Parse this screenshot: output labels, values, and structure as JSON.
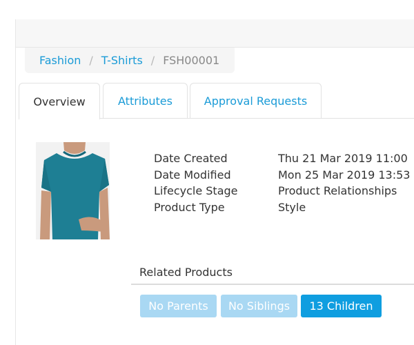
{
  "breadcrumb": {
    "items": [
      {
        "label": "Fashion"
      },
      {
        "label": "T-Shirts"
      }
    ],
    "current": "FSH00001",
    "separator": "/"
  },
  "tabs": [
    {
      "label": "Overview",
      "active": true
    },
    {
      "label": "Attributes",
      "active": false
    },
    {
      "label": "Approval Requests",
      "active": false
    }
  ],
  "product": {
    "image_icon": "product-photo-tshirt",
    "image_colors": {
      "shirt": "#1e7f94",
      "skin": "#c99a7d",
      "background": "#f2f2f2"
    },
    "details": [
      {
        "label": "Date Created",
        "value": "Thu 21 Mar 2019 11:00"
      },
      {
        "label": "Date Modified",
        "value": "Mon 25 Mar 2019 13:53"
      },
      {
        "label": "Lifecycle Stage",
        "value": "Product Relationships"
      },
      {
        "label": "Product Type",
        "value": "Style"
      }
    ]
  },
  "related": {
    "title": "Related Products",
    "buttons": [
      {
        "label": "No Parents",
        "state": "disabled"
      },
      {
        "label": "No Siblings",
        "state": "disabled"
      },
      {
        "label": "13 Children",
        "state": "active"
      }
    ]
  },
  "colors": {
    "link": "#1a9bd7",
    "button_active": "#0f9ee0",
    "button_disabled": "#a9d8f3"
  }
}
